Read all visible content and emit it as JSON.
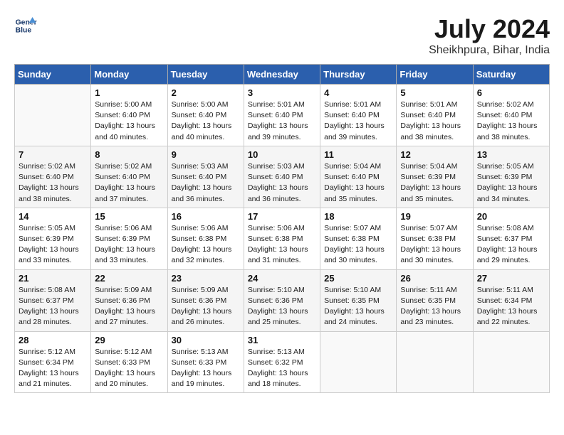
{
  "header": {
    "logo_line1": "General",
    "logo_line2": "Blue",
    "month_title": "July 2024",
    "location": "Sheikhpura, Bihar, India"
  },
  "days_of_week": [
    "Sunday",
    "Monday",
    "Tuesday",
    "Wednesday",
    "Thursday",
    "Friday",
    "Saturday"
  ],
  "weeks": [
    [
      {
        "num": "",
        "lines": []
      },
      {
        "num": "1",
        "lines": [
          "Sunrise: 5:00 AM",
          "Sunset: 6:40 PM",
          "Daylight: 13 hours",
          "and 40 minutes."
        ]
      },
      {
        "num": "2",
        "lines": [
          "Sunrise: 5:00 AM",
          "Sunset: 6:40 PM",
          "Daylight: 13 hours",
          "and 40 minutes."
        ]
      },
      {
        "num": "3",
        "lines": [
          "Sunrise: 5:01 AM",
          "Sunset: 6:40 PM",
          "Daylight: 13 hours",
          "and 39 minutes."
        ]
      },
      {
        "num": "4",
        "lines": [
          "Sunrise: 5:01 AM",
          "Sunset: 6:40 PM",
          "Daylight: 13 hours",
          "and 39 minutes."
        ]
      },
      {
        "num": "5",
        "lines": [
          "Sunrise: 5:01 AM",
          "Sunset: 6:40 PM",
          "Daylight: 13 hours",
          "and 38 minutes."
        ]
      },
      {
        "num": "6",
        "lines": [
          "Sunrise: 5:02 AM",
          "Sunset: 6:40 PM",
          "Daylight: 13 hours",
          "and 38 minutes."
        ]
      }
    ],
    [
      {
        "num": "7",
        "lines": [
          "Sunrise: 5:02 AM",
          "Sunset: 6:40 PM",
          "Daylight: 13 hours",
          "and 38 minutes."
        ]
      },
      {
        "num": "8",
        "lines": [
          "Sunrise: 5:02 AM",
          "Sunset: 6:40 PM",
          "Daylight: 13 hours",
          "and 37 minutes."
        ]
      },
      {
        "num": "9",
        "lines": [
          "Sunrise: 5:03 AM",
          "Sunset: 6:40 PM",
          "Daylight: 13 hours",
          "and 36 minutes."
        ]
      },
      {
        "num": "10",
        "lines": [
          "Sunrise: 5:03 AM",
          "Sunset: 6:40 PM",
          "Daylight: 13 hours",
          "and 36 minutes."
        ]
      },
      {
        "num": "11",
        "lines": [
          "Sunrise: 5:04 AM",
          "Sunset: 6:40 PM",
          "Daylight: 13 hours",
          "and 35 minutes."
        ]
      },
      {
        "num": "12",
        "lines": [
          "Sunrise: 5:04 AM",
          "Sunset: 6:39 PM",
          "Daylight: 13 hours",
          "and 35 minutes."
        ]
      },
      {
        "num": "13",
        "lines": [
          "Sunrise: 5:05 AM",
          "Sunset: 6:39 PM",
          "Daylight: 13 hours",
          "and 34 minutes."
        ]
      }
    ],
    [
      {
        "num": "14",
        "lines": [
          "Sunrise: 5:05 AM",
          "Sunset: 6:39 PM",
          "Daylight: 13 hours",
          "and 33 minutes."
        ]
      },
      {
        "num": "15",
        "lines": [
          "Sunrise: 5:06 AM",
          "Sunset: 6:39 PM",
          "Daylight: 13 hours",
          "and 33 minutes."
        ]
      },
      {
        "num": "16",
        "lines": [
          "Sunrise: 5:06 AM",
          "Sunset: 6:38 PM",
          "Daylight: 13 hours",
          "and 32 minutes."
        ]
      },
      {
        "num": "17",
        "lines": [
          "Sunrise: 5:06 AM",
          "Sunset: 6:38 PM",
          "Daylight: 13 hours",
          "and 31 minutes."
        ]
      },
      {
        "num": "18",
        "lines": [
          "Sunrise: 5:07 AM",
          "Sunset: 6:38 PM",
          "Daylight: 13 hours",
          "and 30 minutes."
        ]
      },
      {
        "num": "19",
        "lines": [
          "Sunrise: 5:07 AM",
          "Sunset: 6:38 PM",
          "Daylight: 13 hours",
          "and 30 minutes."
        ]
      },
      {
        "num": "20",
        "lines": [
          "Sunrise: 5:08 AM",
          "Sunset: 6:37 PM",
          "Daylight: 13 hours",
          "and 29 minutes."
        ]
      }
    ],
    [
      {
        "num": "21",
        "lines": [
          "Sunrise: 5:08 AM",
          "Sunset: 6:37 PM",
          "Daylight: 13 hours",
          "and 28 minutes."
        ]
      },
      {
        "num": "22",
        "lines": [
          "Sunrise: 5:09 AM",
          "Sunset: 6:36 PM",
          "Daylight: 13 hours",
          "and 27 minutes."
        ]
      },
      {
        "num": "23",
        "lines": [
          "Sunrise: 5:09 AM",
          "Sunset: 6:36 PM",
          "Daylight: 13 hours",
          "and 26 minutes."
        ]
      },
      {
        "num": "24",
        "lines": [
          "Sunrise: 5:10 AM",
          "Sunset: 6:36 PM",
          "Daylight: 13 hours",
          "and 25 minutes."
        ]
      },
      {
        "num": "25",
        "lines": [
          "Sunrise: 5:10 AM",
          "Sunset: 6:35 PM",
          "Daylight: 13 hours",
          "and 24 minutes."
        ]
      },
      {
        "num": "26",
        "lines": [
          "Sunrise: 5:11 AM",
          "Sunset: 6:35 PM",
          "Daylight: 13 hours",
          "and 23 minutes."
        ]
      },
      {
        "num": "27",
        "lines": [
          "Sunrise: 5:11 AM",
          "Sunset: 6:34 PM",
          "Daylight: 13 hours",
          "and 22 minutes."
        ]
      }
    ],
    [
      {
        "num": "28",
        "lines": [
          "Sunrise: 5:12 AM",
          "Sunset: 6:34 PM",
          "Daylight: 13 hours",
          "and 21 minutes."
        ]
      },
      {
        "num": "29",
        "lines": [
          "Sunrise: 5:12 AM",
          "Sunset: 6:33 PM",
          "Daylight: 13 hours",
          "and 20 minutes."
        ]
      },
      {
        "num": "30",
        "lines": [
          "Sunrise: 5:13 AM",
          "Sunset: 6:33 PM",
          "Daylight: 13 hours",
          "and 19 minutes."
        ]
      },
      {
        "num": "31",
        "lines": [
          "Sunrise: 5:13 AM",
          "Sunset: 6:32 PM",
          "Daylight: 13 hours",
          "and 18 minutes."
        ]
      },
      {
        "num": "",
        "lines": []
      },
      {
        "num": "",
        "lines": []
      },
      {
        "num": "",
        "lines": []
      }
    ]
  ]
}
